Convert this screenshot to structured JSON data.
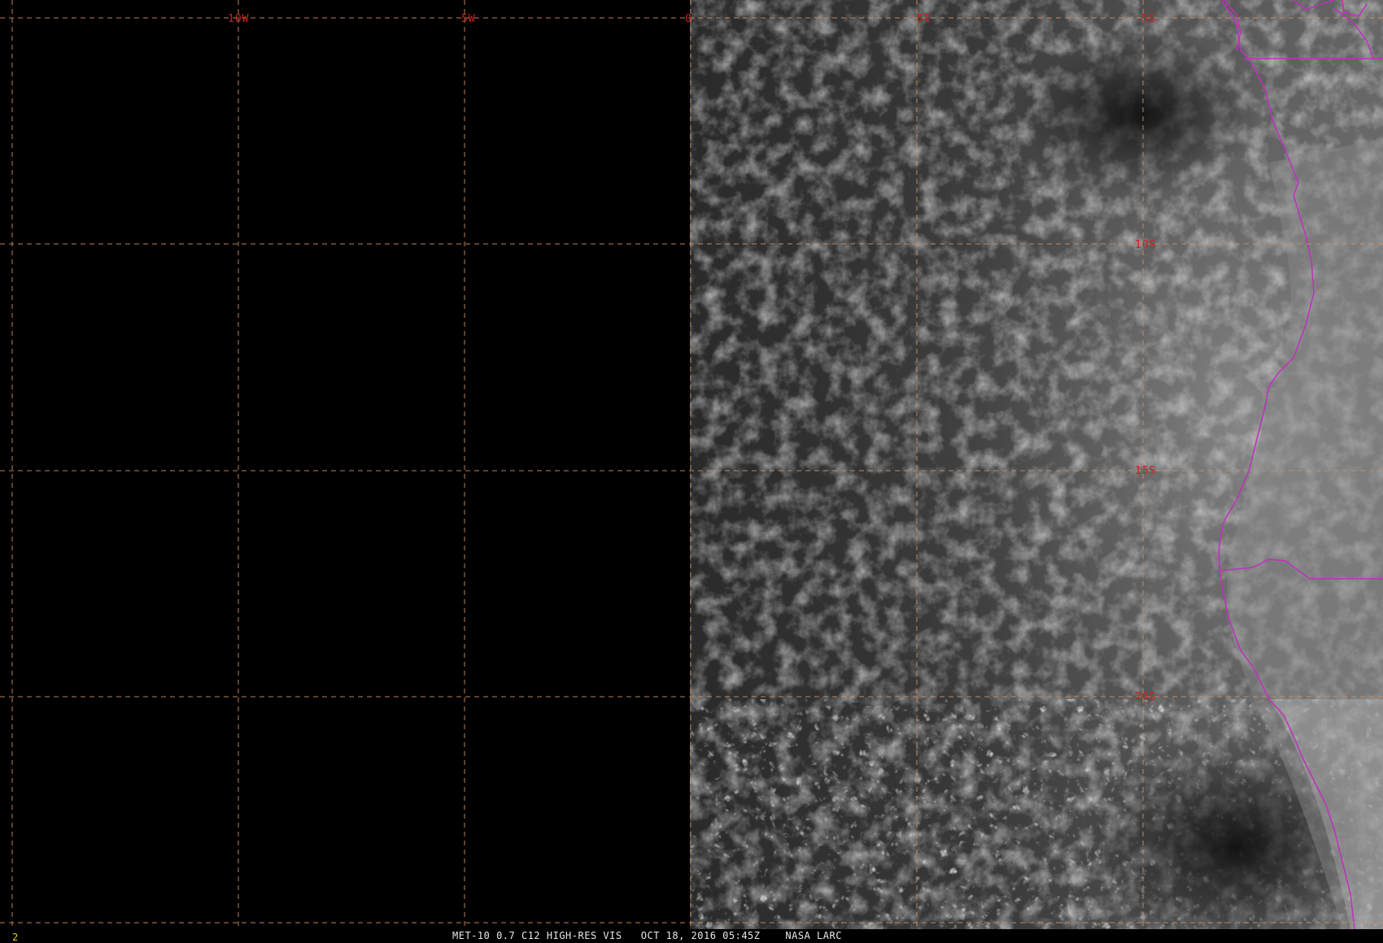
{
  "image": {
    "kind": "satellite-visible-imagery",
    "satellite": "MET-10",
    "colors": {
      "background": "#000000",
      "grid": "#d09060",
      "grid_label": "#cc2222",
      "borders": "#c030c0",
      "frame_number": "#e0d020",
      "caption": "#e8e8e8"
    }
  },
  "grid": {
    "lon_labels": [
      "10W",
      "5W",
      "0",
      "5E",
      "5S"
    ],
    "lat_labels": [
      "10S",
      "15S",
      "20S"
    ]
  },
  "footer": {
    "frame_number": "2",
    "caption": "MET-10 0.7 C12 HIGH-RES VIS   OCT 18, 2016 05:45Z    NASA LARC"
  }
}
